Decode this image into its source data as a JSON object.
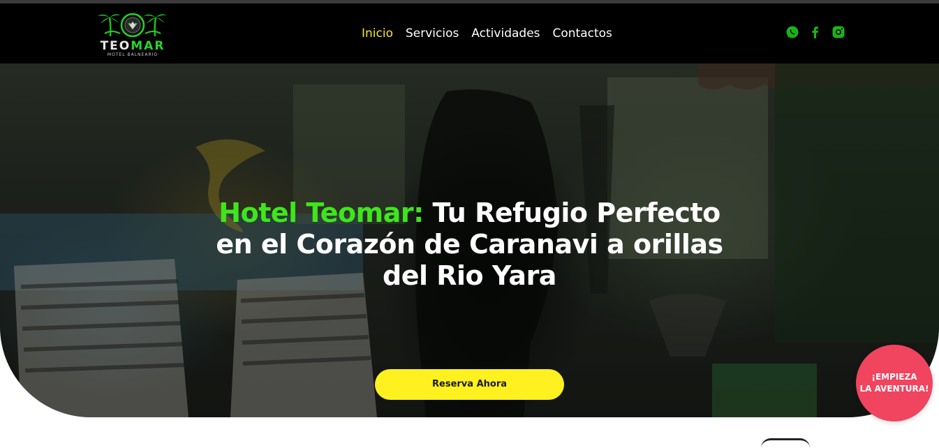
{
  "brand": {
    "logo_main": "TEO",
    "logo_accent": "MAR",
    "logo_subtitle": "MOTEL BALNEARIO",
    "accent_color": "#2bd42b"
  },
  "nav": {
    "items": [
      {
        "label": "Inicio",
        "active": true
      },
      {
        "label": "Servicios",
        "active": false
      },
      {
        "label": "Actividades",
        "active": false
      },
      {
        "label": "Contactos",
        "active": false
      }
    ],
    "active_color": "#f7e52a"
  },
  "social": {
    "icons": [
      "whatsapp-icon",
      "facebook-icon",
      "instagram-icon"
    ],
    "color": "#19b319"
  },
  "hero": {
    "title_highlight": "Hotel Teomar:",
    "title_rest": " Tu Refugio Perfecto en el Corazón de Caranavi a orillas del Rio Yara",
    "highlight_color": "#3ee61c",
    "cta_label": "Reserva Ahora",
    "cta_color": "#fff11f"
  },
  "badge": {
    "line1": "¡EMPIEZA",
    "line2": "LA AVENTURA!",
    "color": "#f0445f"
  }
}
